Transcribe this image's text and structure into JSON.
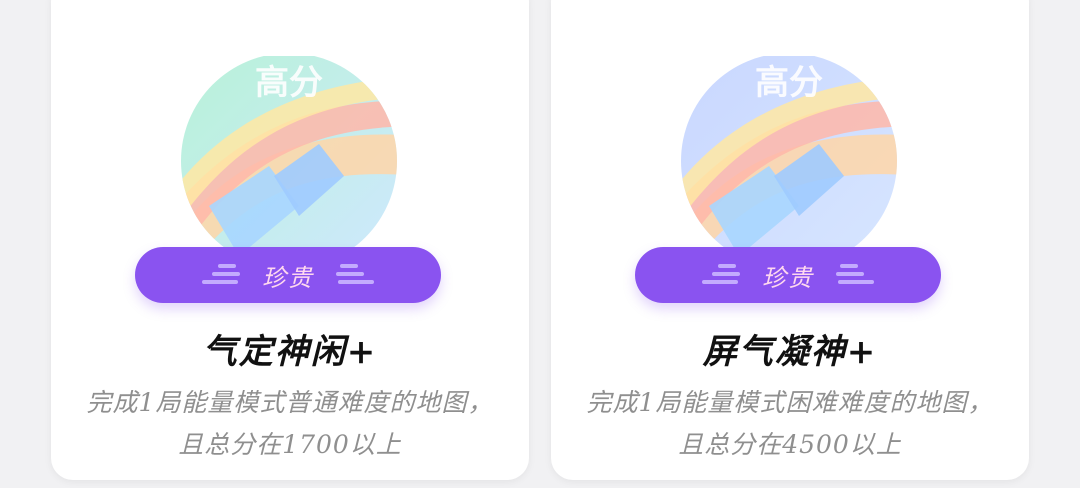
{
  "cards": [
    {
      "art_label": "高分",
      "rarity_label": "珍贵",
      "title": "气定神闲+",
      "description": "完成1局能量模式普通难度的地图，且总分在1700以上"
    },
    {
      "art_label": "高分",
      "rarity_label": "珍贵",
      "title": "屏气凝神+",
      "description": "完成1局能量模式困难难度的地图，且总分在4500以上"
    }
  ]
}
